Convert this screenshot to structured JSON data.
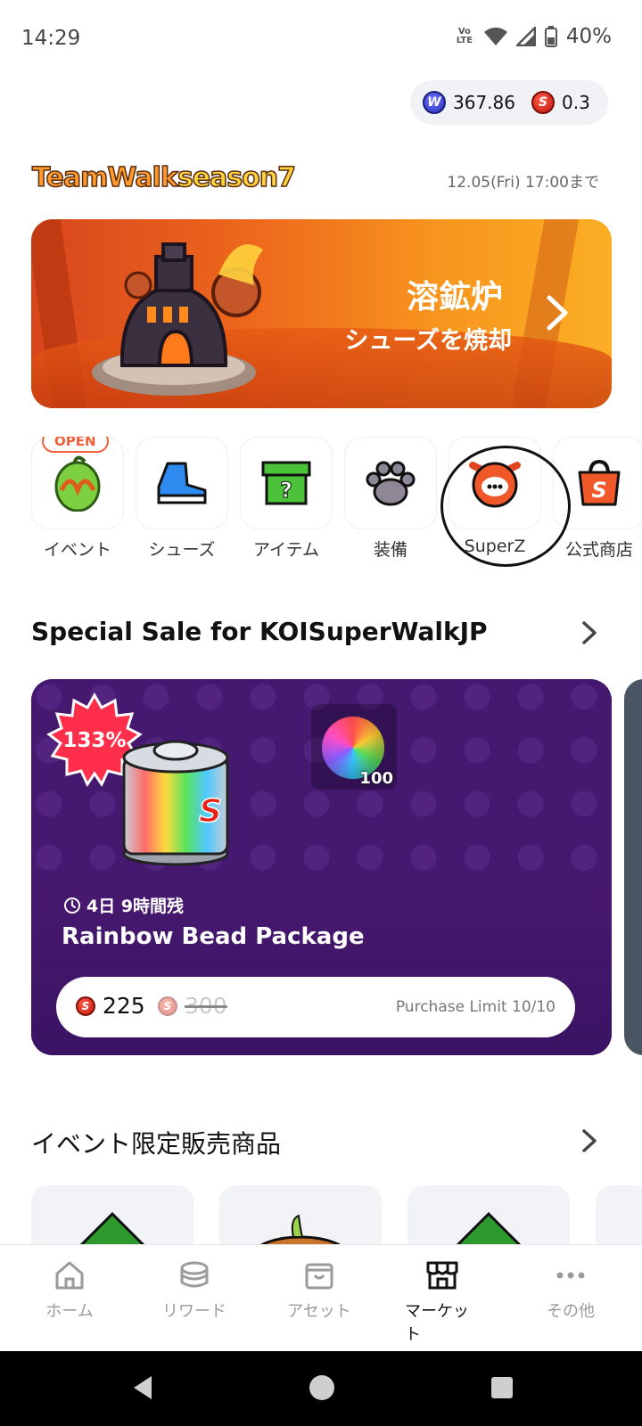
{
  "status_bar": {
    "time": "14:29",
    "network": "VoLTE",
    "battery": "40%"
  },
  "balance": {
    "w_amount": "367.86",
    "s_amount": "0.3",
    "w_symbol": "W",
    "s_symbol": "S"
  },
  "season": {
    "logo_part1": "TeamWalk",
    "logo_part2": "season7",
    "deadline": "12.05(Fri) 17:00まで"
  },
  "banner": {
    "title": "溶鉱炉",
    "subtitle": "シューズを焼却"
  },
  "categories": {
    "open_badge": "OPEN",
    "items": [
      {
        "label": "イベント"
      },
      {
        "label": "シューズ"
      },
      {
        "label": "アイテム"
      },
      {
        "label": "装備"
      },
      {
        "label": "SuperZ"
      },
      {
        "label": "公式商店"
      }
    ]
  },
  "special_sale": {
    "section_title": "Special Sale for KOISuperWalkJP",
    "card": {
      "discount_badge": "133%",
      "bead_count": "100",
      "timer": "4日 9時間残",
      "name": "Rainbow Bead Package",
      "price_current": "225",
      "price_original": "300",
      "purchase_limit": "Purchase Limit 10/10"
    }
  },
  "event_section": {
    "title": "イベント限定販売商品"
  },
  "bottom_nav": {
    "items": [
      {
        "label": "ホーム",
        "icon": "home-icon"
      },
      {
        "label": "リワード",
        "icon": "coins-icon"
      },
      {
        "label": "アセット",
        "icon": "box-icon"
      },
      {
        "label": "マーケット",
        "icon": "store-icon"
      },
      {
        "label": "その他",
        "icon": "more-icon"
      }
    ],
    "active_index": 3
  },
  "colors": {
    "accent_orange": "#f0603a",
    "sale_card_purple": "#3d1669",
    "banner_orange": "#f7951e"
  }
}
